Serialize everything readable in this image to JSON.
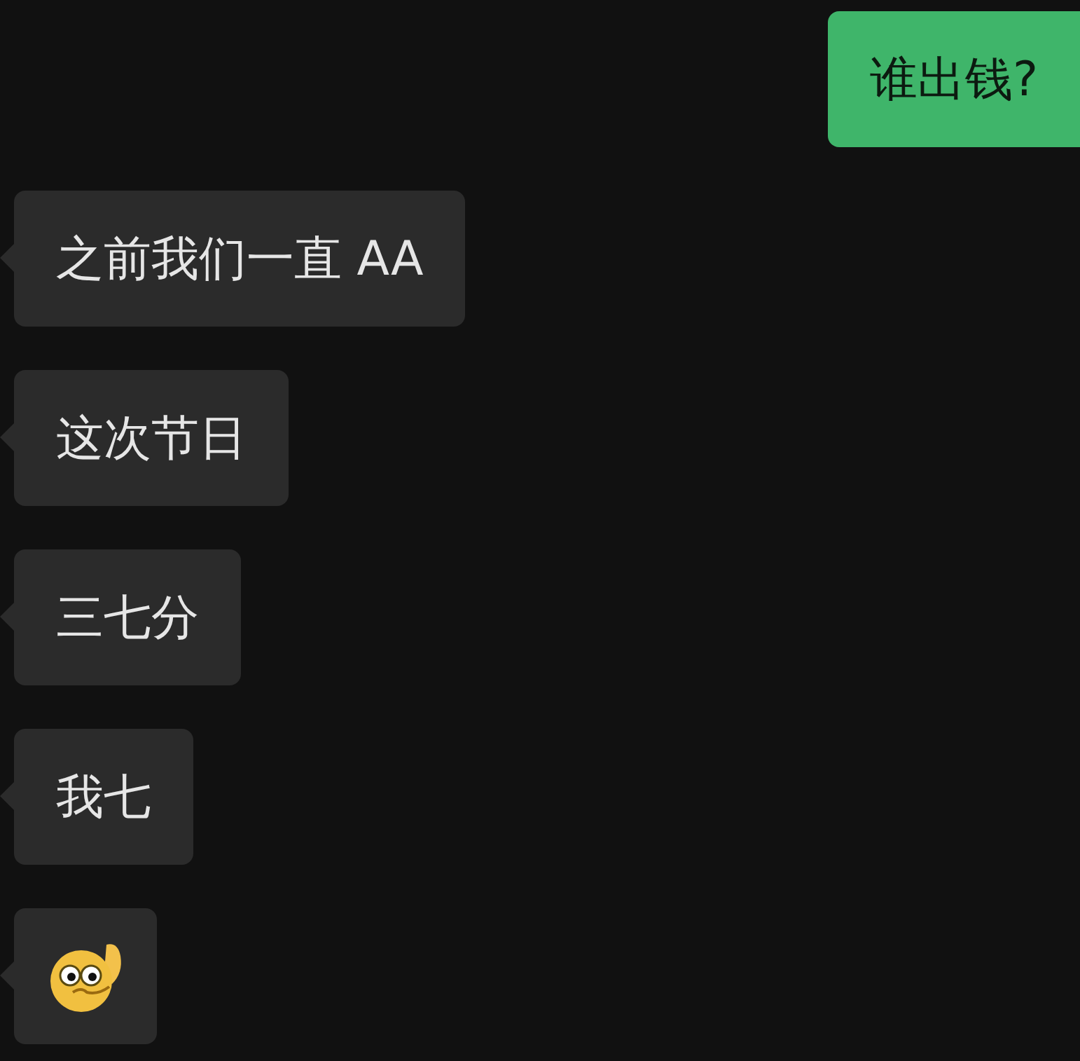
{
  "messages": [
    {
      "outgoing": true,
      "kind": "text",
      "text": "谁出钱?"
    },
    {
      "outgoing": false,
      "kind": "text",
      "text": "之前我们一直 AA"
    },
    {
      "outgoing": false,
      "kind": "text",
      "text": "这次节日"
    },
    {
      "outgoing": false,
      "kind": "text",
      "text": "三七分"
    },
    {
      "outgoing": false,
      "kind": "text",
      "text": "我七"
    },
    {
      "outgoing": false,
      "kind": "emoji"
    }
  ]
}
